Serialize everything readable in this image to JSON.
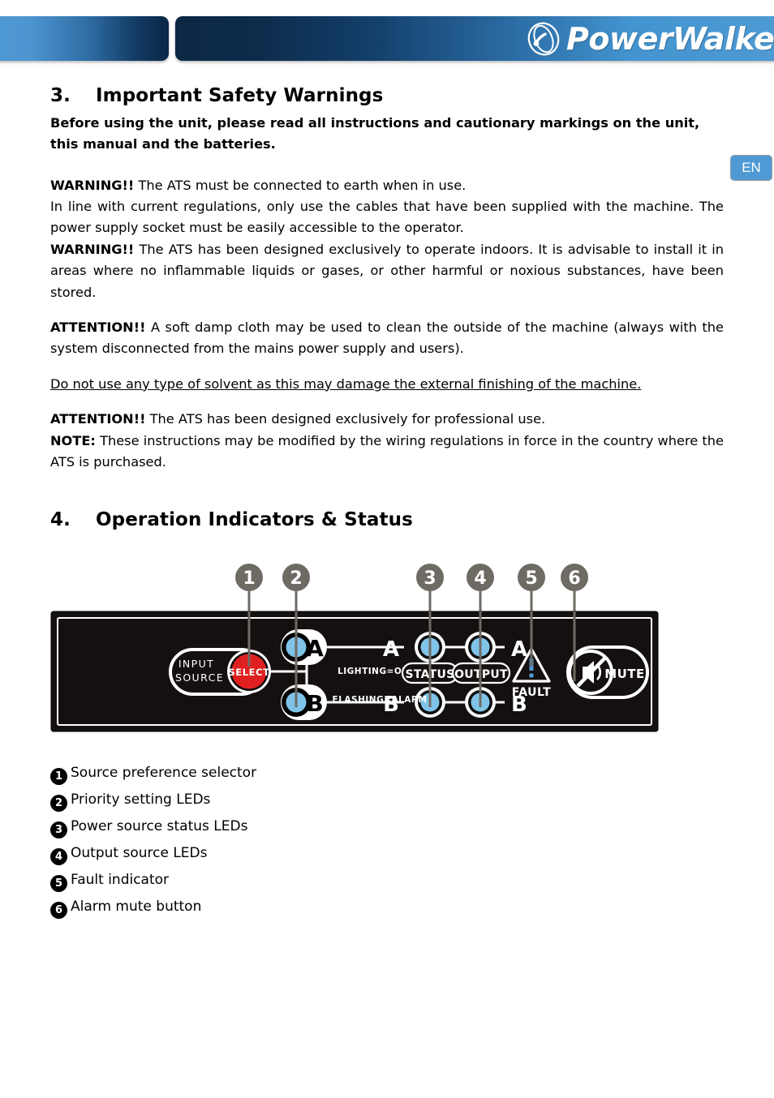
{
  "header": {
    "logo_text": "PowerWalker",
    "logo_icon": "powerwalker-swoosh-icon"
  },
  "lang_badge": {
    "label": "EN"
  },
  "sections": {
    "safety": {
      "number": "3.",
      "title": "Important Safety Warnings",
      "intro": "Before using the unit, please read all instructions and cautionary markings on the unit, this manual and the batteries.",
      "paragraphs": [
        {
          "lead": "WARNING!!",
          "text": " The ATS must be connected to earth when in use."
        },
        {
          "lead": "",
          "text": "In line with current regulations, only use the cables that have been supplied with the machine. The power supply socket must be easily accessible to the operator."
        },
        {
          "lead": "WARNING!!",
          "text": " The ATS has been designed exclusively to operate indoors. It is advisable to install it in areas where no inflammable liquids or gases, or other harmful or noxious substances, have been stored."
        }
      ],
      "attention_clean": {
        "lead": "ATTENTION!!",
        "text": " A soft damp cloth may be used to clean the outside of the machine (always with the system disconnected from the mains power supply and users)."
      },
      "solvent_warning": "Do not use any type of solvent as this may damage the external finishing of the machine.",
      "attention_professional": {
        "lead": "ATTENTION!!",
        "text": " The ATS has been designed exclusively for professional use."
      },
      "note": {
        "lead": "NOTE:",
        "text": " These instructions may be modified by the wiring regulations in force in the country where the ATS is purchased."
      }
    },
    "operation": {
      "number": "4.",
      "title": "Operation Indicators & Status"
    }
  },
  "panel": {
    "callouts": [
      "1",
      "2",
      "3",
      "4",
      "5",
      "6"
    ],
    "input_source_line1": "INPUT",
    "input_source_line2": "SOURCE",
    "select_button": "SELECT",
    "priority_led_a": "A",
    "priority_led_b": "B",
    "status_led_a": "A",
    "status_led_b": "B",
    "output_led_a": "A",
    "output_led_b": "B",
    "lighting_note": "LIGHTING=OK",
    "flashing_note": "FLASHING=ALARM",
    "status_pill": "STATUS",
    "output_pill": "OUTPUT",
    "fault_label": "FAULT",
    "fault_icon": "warning-triangle-icon",
    "mute_label": "MUTE",
    "mute_icon": "speaker-muted-icon"
  },
  "legend": {
    "items": [
      {
        "bullet": "1",
        "label": "Source preference selector"
      },
      {
        "bullet": "2",
        "label": "Priority setting LEDs"
      },
      {
        "bullet": "3",
        "label": "Power source status LEDs"
      },
      {
        "bullet": "4",
        "label": "Output source LEDs"
      },
      {
        "bullet": "5",
        "label": "Fault indicator"
      },
      {
        "bullet": "6",
        "label": "Alarm mute button"
      }
    ]
  },
  "colors": {
    "brand_blue": "#4f9ad4",
    "brand_dark": "#0b2744",
    "led_blue": "#7fc4e8",
    "select_red": "#e02020",
    "panel_black": "#14100f",
    "callout_gray": "#6e6a64"
  }
}
